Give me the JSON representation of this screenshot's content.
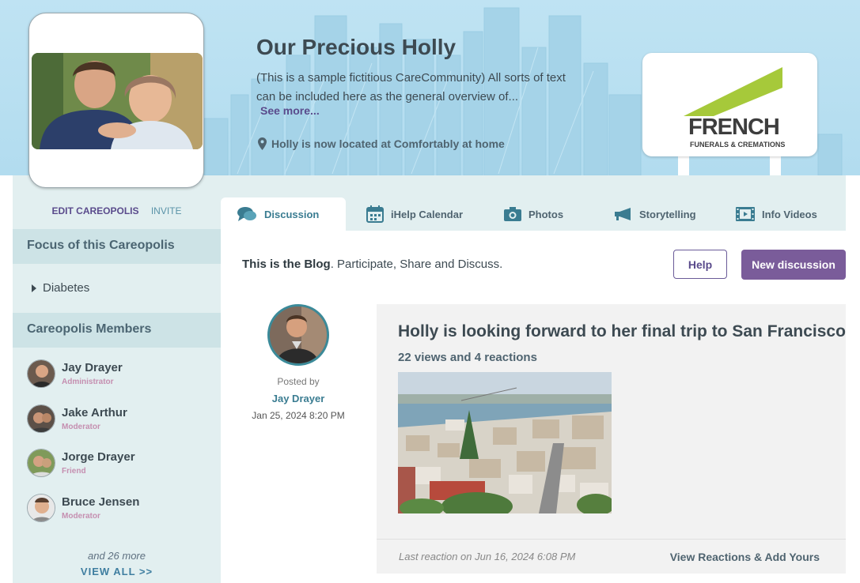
{
  "header": {
    "title": "Our Precious Holly",
    "intro": "(This is a sample fictitious CareCommunity)  All sorts of text can be included here as the general overview of...",
    "see_more": "See more...",
    "location": "Holly is now located at Comfortably at home",
    "logo": {
      "name": "FRENCH",
      "tagline": "FUNERALS & CREMATIONS"
    }
  },
  "sidebar": {
    "edit_label": "EDIT CAREOPOLIS",
    "invite_label": "INVITE",
    "focus_heading": "Focus of this Careopolis",
    "focus_items": [
      "Diabetes"
    ],
    "members_heading": "Careopolis Members",
    "members": [
      {
        "name": "Jay Drayer",
        "role": "Administrator"
      },
      {
        "name": "Jake Arthur",
        "role": "Moderator"
      },
      {
        "name": "Jorge Drayer",
        "role": "Friend"
      },
      {
        "name": "Bruce Jensen",
        "role": "Moderator"
      }
    ],
    "and_more": "and 26 more",
    "view_all": "VIEW ALL >>"
  },
  "tabs": [
    {
      "label": "Discussion",
      "icon": "chat-bubbles-icon",
      "active": true
    },
    {
      "label": "iHelp Calendar",
      "icon": "calendar-icon",
      "active": false
    },
    {
      "label": "Photos",
      "icon": "camera-icon",
      "active": false
    },
    {
      "label": "Storytelling",
      "icon": "megaphone-icon",
      "active": false
    },
    {
      "label": "Info Videos",
      "icon": "film-icon",
      "active": false
    }
  ],
  "main": {
    "blog_intro_bold": "This is the Blog",
    "blog_intro_rest": ". Participate, Share and Discuss.",
    "help_button": "Help",
    "new_discussion_button": "New discussion"
  },
  "post": {
    "posted_by_label": "Posted by",
    "author": "Jay Drayer",
    "date": "Jan 25, 2024 8:20 PM",
    "title": "Holly is looking forward to her final trip to San Francisco",
    "stats": "22 views and 4 reactions",
    "last_reaction": "Last reaction on Jun 16, 2024 6:08 PM",
    "view_reactions": "View Reactions & Add Yours"
  },
  "colors": {
    "header_bg": "#b2dcef",
    "sidebar_bg": "#e2eff0",
    "section_head_bg": "#cde3e6",
    "accent_purple": "#7a5c9a",
    "accent_teal": "#3a7c91",
    "logo_green": "#a6c93a"
  }
}
